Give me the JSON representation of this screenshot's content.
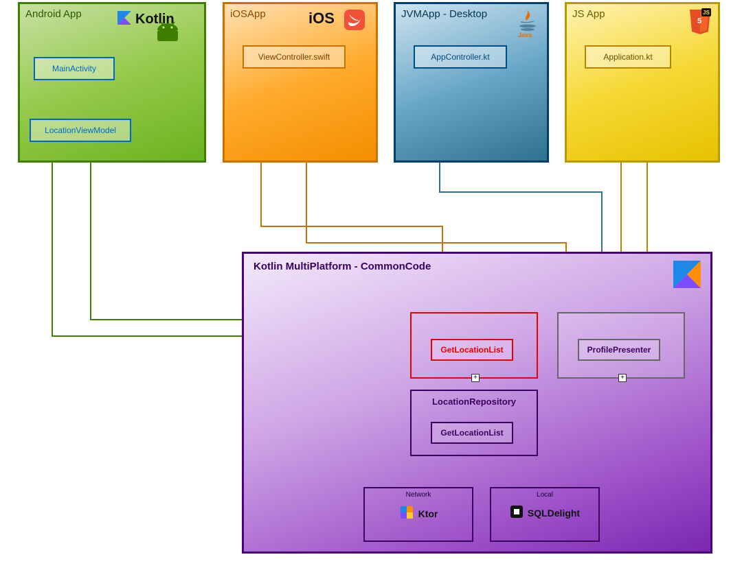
{
  "platforms": {
    "android": {
      "title": "Android App",
      "files": [
        "MainActivity",
        "LocationViewModel"
      ],
      "brand": "Kotlin",
      "color": "#3f7f00"
    },
    "ios": {
      "title": "iOSApp",
      "files": [
        "ViewController.swift"
      ],
      "brand": "iOS Swift",
      "color": "#cc7100"
    },
    "jvm": {
      "title": "JVMApp - Desktop",
      "files": [
        "AppController.kt"
      ],
      "brand": "Java",
      "color": "#003e6b"
    },
    "js": {
      "title": "JS App",
      "files": [
        "Application.kt"
      ],
      "brand": "JS/HTML5",
      "color": "#b39b00"
    }
  },
  "common": {
    "title": "Kotlin MultiPlatform - CommonCode",
    "brand": "Kotlin",
    "usecase_box": {
      "inner": "GetLocationList"
    },
    "presenter_box": {
      "inner": "ProfilePresenter"
    },
    "repository_box": {
      "title": "LocationRepository",
      "inner": "GetLocationList"
    },
    "network_box": {
      "title": "Network",
      "lib": "Ktor"
    },
    "local_box": {
      "title": "Local",
      "lib": "SQLDelight"
    }
  },
  "connections": [
    {
      "from": "android.LocationViewModel",
      "to": "common.usecase",
      "bidir": false,
      "color": "#3f7f00"
    },
    {
      "from": "android.MainActivity",
      "to": "android.LocationViewModel",
      "bidir": true,
      "color": "#0066cc"
    },
    {
      "from": "ios.ViewController.swift",
      "to": "common.presenter",
      "bidir": true,
      "color": "#cc7100"
    },
    {
      "from": "ios.ViewController.swift",
      "to": "common.usecase",
      "bidir": false,
      "color": "#cc7100"
    },
    {
      "from": "jvm.AppController.kt",
      "to": "common.presenter",
      "bidir": true,
      "color": "#2f7191"
    },
    {
      "from": "js.Application.kt",
      "to": "common.presenter",
      "bidir": true,
      "color": "#b38600"
    },
    {
      "from": "common.usecase",
      "to": "common.presenter",
      "bidir": true,
      "color": "#000"
    },
    {
      "from": "common.usecase",
      "to": "common.repository",
      "bidir": true,
      "color": "#000"
    },
    {
      "from": "common.repository",
      "to": "common.network",
      "bidir": false,
      "color": "#000"
    },
    {
      "from": "common.repository",
      "to": "common.local",
      "bidir": false,
      "color": "#000"
    }
  ]
}
